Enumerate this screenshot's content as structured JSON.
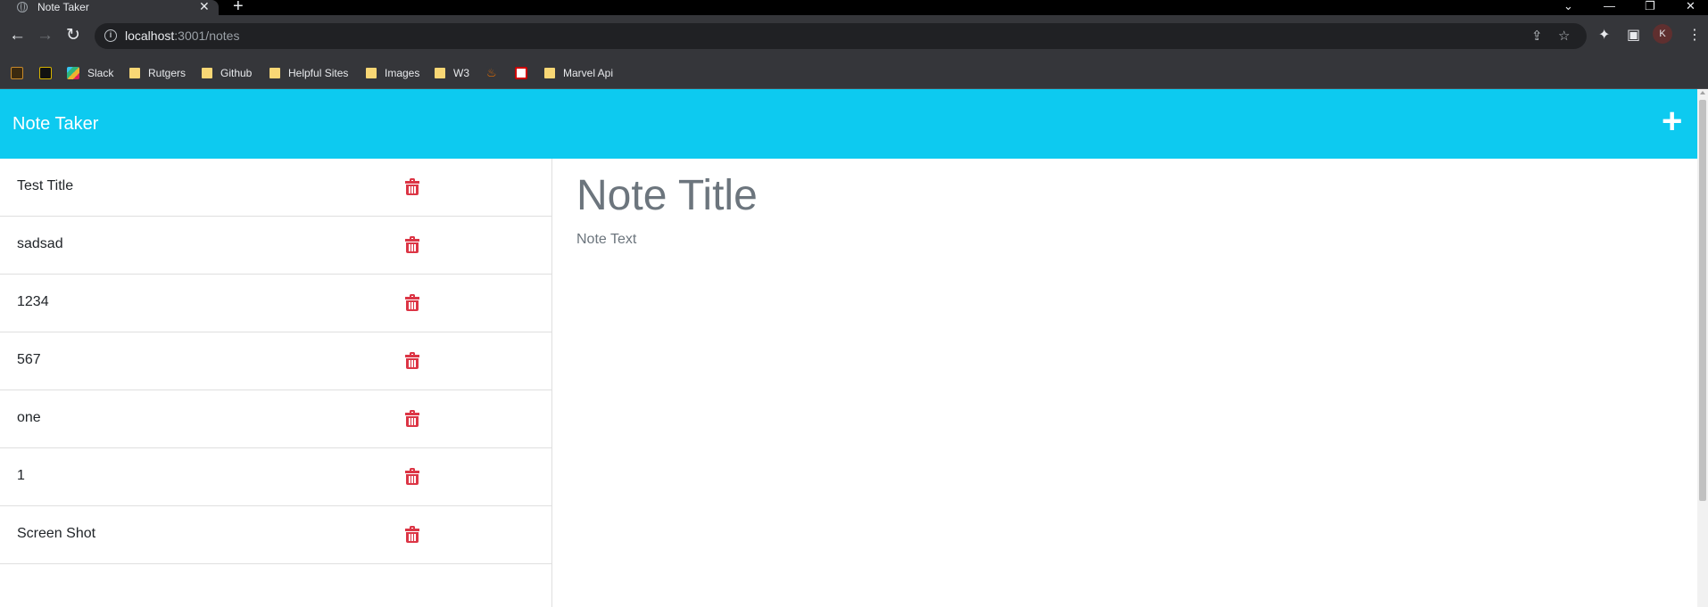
{
  "browser": {
    "tab_title": "Note Taker",
    "tab_close": "✕",
    "new_tab": "+",
    "url_host": "localhost",
    "url_path": ":3001/notes",
    "profile_initial": "K",
    "bookmarks": [
      {
        "label": "Slack",
        "icon": "slack-icon"
      },
      {
        "label": "Rutgers",
        "icon": "folder-icon"
      },
      {
        "label": "Github",
        "icon": "folder-icon"
      },
      {
        "label": "Helpful Sites",
        "icon": "folder-icon"
      },
      {
        "label": "Images",
        "icon": "folder-icon"
      },
      {
        "label": "W3",
        "icon": "folder-icon"
      },
      {
        "label": "Marvel Api",
        "icon": "folder-icon"
      }
    ]
  },
  "app": {
    "brand": "Note Taker",
    "new_note_icon": "+",
    "accent_color": "#0dcaf0",
    "delete_color": "#dc3545"
  },
  "notes": [
    {
      "title": "Test Title"
    },
    {
      "title": "sadsad"
    },
    {
      "title": "1234"
    },
    {
      "title": "567"
    },
    {
      "title": "one"
    },
    {
      "title": "1"
    },
    {
      "title": "Screen Shot"
    }
  ],
  "editor": {
    "title_placeholder": "Note Title",
    "text_placeholder": "Note Text"
  }
}
